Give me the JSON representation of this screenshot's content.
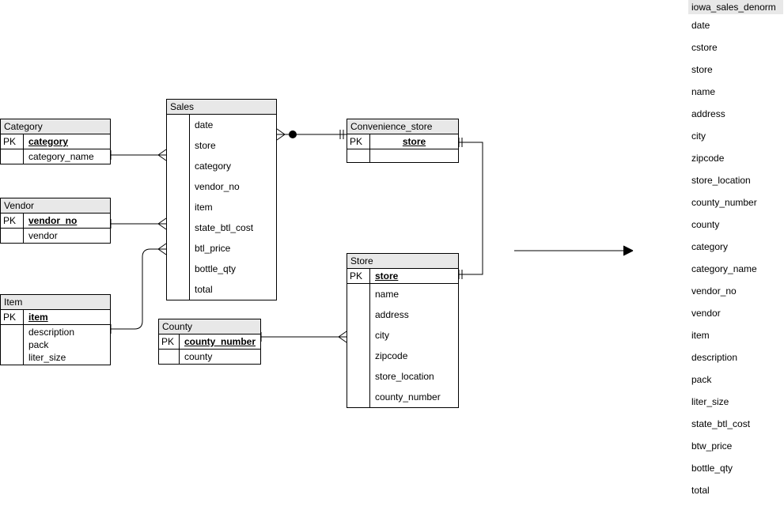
{
  "entities": {
    "category": {
      "title": "Category",
      "pk_label": "PK",
      "pk_field": "category",
      "fields": [
        "category_name"
      ]
    },
    "vendor": {
      "title": "Vendor",
      "pk_label": "PK",
      "pk_field": "vendor_no",
      "fields": [
        "vendor"
      ]
    },
    "item": {
      "title": "Item",
      "pk_label": "PK",
      "pk_field": "item",
      "fields": [
        "description",
        "pack",
        "liter_size"
      ]
    },
    "sales": {
      "title": "Sales",
      "fields": [
        "date",
        "store",
        "category",
        "vendor_no",
        "item",
        "state_btl_cost",
        "btl_price",
        "bottle_qty",
        "total"
      ]
    },
    "county": {
      "title": "County",
      "pk_label": "PK",
      "pk_field": "county_number",
      "fields": [
        "county"
      ]
    },
    "conv_store": {
      "title": "Convenience_store",
      "pk_label": "PK",
      "pk_field": "store"
    },
    "store": {
      "title": "Store",
      "pk_label": "PK",
      "pk_field": "store",
      "fields": [
        "name",
        "address",
        "city",
        "zipcode",
        "store_location",
        "county_number"
      ]
    }
  },
  "denorm": {
    "title": "iowa_sales_denorm",
    "fields": [
      "date",
      "cstore",
      "store",
      "name",
      "address",
      "city",
      "zipcode",
      "store_location",
      "county_number",
      "county",
      "category",
      "category_name",
      "vendor_no",
      "vendor",
      "item",
      "description",
      "pack",
      "liter_size",
      "state_btl_cost",
      "btw_price",
      "bottle_qty",
      "total"
    ]
  }
}
